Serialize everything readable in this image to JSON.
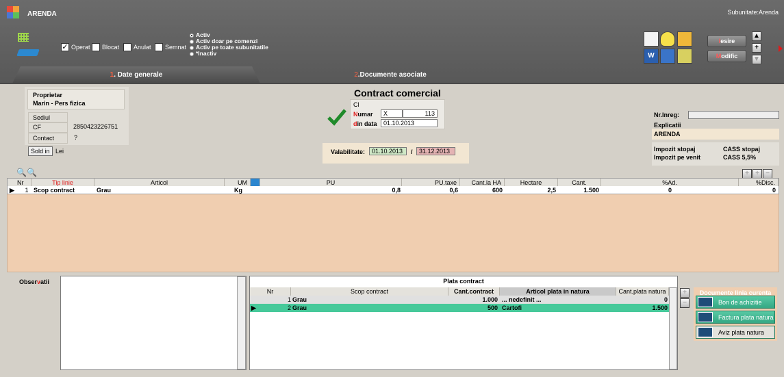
{
  "window": {
    "title": "ARENDA",
    "subunit": "Subunitate:Arenda"
  },
  "toolbar": {
    "checkboxes": [
      {
        "label": "Operat",
        "checked": true
      },
      {
        "label": "Blocat",
        "checked": false
      },
      {
        "label": "Anulat",
        "checked": false
      },
      {
        "label": "Semnat",
        "checked": false
      }
    ],
    "radios": [
      "Activ",
      "Activ doar pe comenzi",
      "Activ pe toate subunitatile",
      "*Inactiv"
    ],
    "iesire_hotkey": "I",
    "iesire_rest": "esire",
    "modific_hotkey": "M",
    "modific_rest": "odific",
    "plus": "+",
    "up": "▲",
    "down": "▼"
  },
  "tabs": [
    {
      "num": "1",
      "label": ". Date generale"
    },
    {
      "num": "2",
      "label": ".Documente asociate"
    }
  ],
  "owner": {
    "title": "Proprietar",
    "name": "Marin - Pers fizica",
    "sediul_label": "Sediul",
    "cf_label": "CF",
    "cf_value": "2850423226751",
    "contact_label": "Contact",
    "contact_value": "?",
    "sold_button": "Sold in",
    "currency": "Lei"
  },
  "contract": {
    "title": "Contract comercial",
    "type": "Cl",
    "numar_hotkey": "N",
    "numar_rest": "umar",
    "series": "X",
    "number": "113",
    "date_hotkey": "d",
    "date_rest": "in data",
    "date": "01.10.2013",
    "validity_label": "Valabilitate:",
    "validity_from": "01.10.2013",
    "validity_sep": "/",
    "validity_to": "31.12.2013"
  },
  "right_panel": {
    "nr_inreg_label": "Nr.Inreg:",
    "nr_inreg_value": "",
    "explicatii_label": "Explicatii",
    "explicatii_value": "ARENDA",
    "impozit_stopaj": "Impozit stopaj",
    "impozit_venit": "Impozit pe venit",
    "cass_stopaj": "CASS stopaj",
    "cass_pct": "CASS 5,5%"
  },
  "grid": {
    "headers": {
      "nr": "Nr",
      "tip": "Tip linie",
      "articol": "Articol",
      "um": "UM",
      "pu": "PU",
      "pu_taxe": "PU.taxe",
      "cant_ha": "Cant.la HA",
      "hectare": "Hectare",
      "cant": "Cant.",
      "ad": "%Ad.",
      "disc": "%Disc."
    },
    "row": {
      "nr": "1",
      "tip": "Scop contract",
      "articol": "Grau",
      "um": "Kg",
      "pu": "0,8",
      "pu_taxe": "0,6",
      "cant_ha": "600",
      "hectare": "2,5",
      "cant": "1.500",
      "ad": "0",
      "disc": "0"
    }
  },
  "observatii": {
    "label_a": "Obser",
    "label_hotkey": "v",
    "label_b": "atii"
  },
  "plata": {
    "title": "Plata contract",
    "headers": {
      "nr": "Nr",
      "scop": "Scop contract",
      "cant": "Cant.contract",
      "articol": "Articol plata in natura",
      "cant_natura": "Cant.plata natura"
    },
    "rows": [
      {
        "nr": "1",
        "scop": "Grau",
        "cant": "1.000",
        "articol": "... nedefinit ...",
        "cant_natura": "0"
      },
      {
        "nr": "2",
        "scop": "Grau",
        "cant": "500",
        "articol": "Cartofi",
        "cant_natura": "1.500"
      }
    ]
  },
  "documente": {
    "title": "Documente linia curenta",
    "buttons": [
      "Bon de achizitie",
      "Factura plata natura",
      "Aviz plata natura"
    ]
  }
}
